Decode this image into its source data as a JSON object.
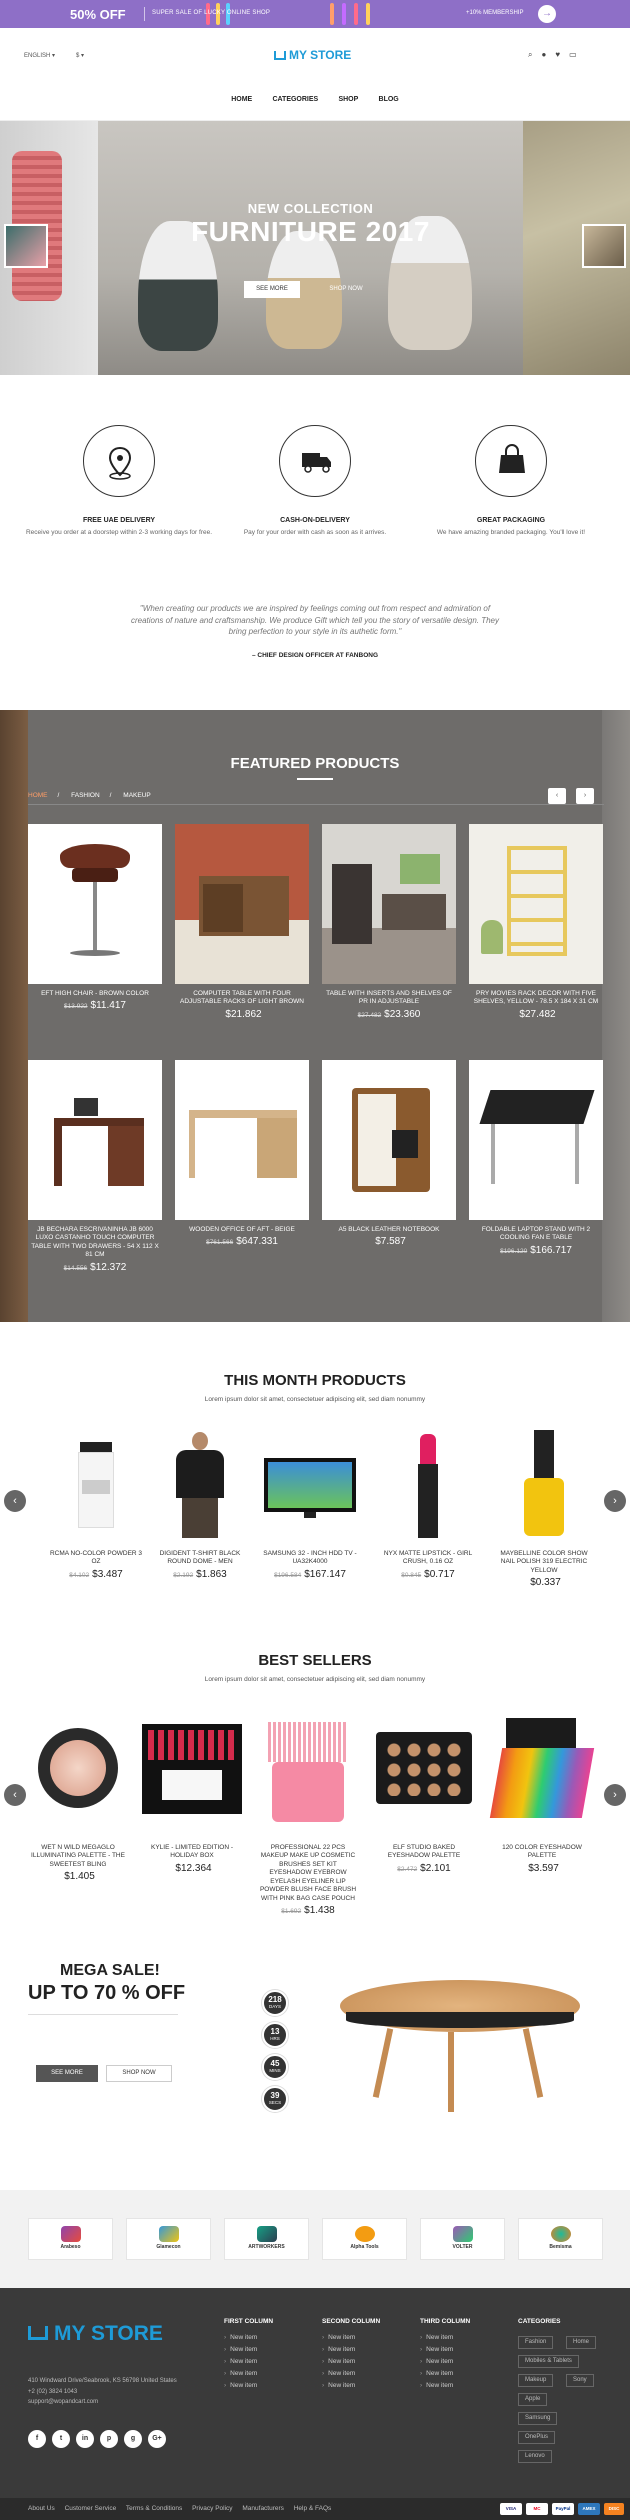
{
  "promo": {
    "percent": "50% OFF",
    "sale_text": "SUPER SALE OF LUCKY ONLINE SHOP",
    "membership": "+10% MEMBERSHIP",
    "arrow": "→"
  },
  "header": {
    "language": "ENGLISH",
    "currency": "$",
    "logo": "MY STORE",
    "icons": [
      "search-icon",
      "user-icon",
      "heart-icon",
      "cart-icon"
    ],
    "nav": [
      "HOME",
      "CATEGORIES",
      "SHOP",
      "BLOG"
    ]
  },
  "hero": {
    "kicker": "NEW COLLECTION",
    "title": "FURNITURE 2017",
    "btn_primary": "SEE MORE",
    "btn_secondary": "SHOP NOW"
  },
  "features": [
    {
      "title": "FREE UAE DELIVERY",
      "desc": "Receive you order at a doorstep within 2-3 working days for free.",
      "icon": "map-pin-icon"
    },
    {
      "title": "CASH-ON-DELIVERY",
      "desc": "Pay for your order with cash as soon as it arrives.",
      "icon": "truck-icon"
    },
    {
      "title": "GREAT PACKAGING",
      "desc": "We have amazing branded packaging. You'll love it!",
      "icon": "shopping-bag-icon"
    }
  ],
  "quote": {
    "text": "\"When creating our products we are inspired by feelings coming out from respect and admiration of creations of nature and craftsmanship. We produce Gift which tell you the story of versatile design. They bring perfection to your style in its authetic form.\"",
    "author": "– CHIEF DESIGN OFFICER AT FANBONG"
  },
  "featured": {
    "title": "FEATURED PRODUCTS",
    "tabs": [
      "HOME",
      "FASHION",
      "MAKEUP"
    ],
    "products": [
      {
        "name": "EFT HIGH CHAIR - BROWN COLOR",
        "old": "$13.922",
        "price": "$11.417"
      },
      {
        "name": "COMPUTER TABLE WITH FOUR ADJUSTABLE RACKS OF LIGHT BROWN",
        "old": "",
        "price": "$21.862"
      },
      {
        "name": "TABLE WITH INSERTS AND SHELVES OF PR IN ADJUSTABLE",
        "old": "$27.482",
        "price": "$23.360"
      },
      {
        "name": "PRY MOVIES RACK DECOR WITH FIVE SHELVES, YELLOW - 78.5 X 184 X 31 CM",
        "old": "",
        "price": "$27.482"
      },
      {
        "name": "JB BECHARA ESCRIVANINHA JB 6000 LUXO CASTANHO TOUCH COMPUTER TABLE WITH TWO DRAWERS - 54 X 112 X 81 CM",
        "old": "$14.556",
        "price": "$12.372"
      },
      {
        "name": "WOODEN OFFICE OF AFT - BEIGE",
        "old": "$761.566",
        "price": "$647.331"
      },
      {
        "name": "A5 BLACK LEATHER NOTEBOOK",
        "old": "",
        "price": "$7.587"
      },
      {
        "name": "FOLDABLE LAPTOP STAND WITH 2 COOLING FAN E TABLE",
        "old": "$196.120",
        "price": "$166.717"
      }
    ]
  },
  "month": {
    "title": "THIS MONTH PRODUCTS",
    "subtitle": "Lorem ipsum dolor sit amet, consectetuer adipiscing elit, sed diam nonummy",
    "items": [
      {
        "name": "RCMA NO-COLOR POWDER 3 OZ",
        "old": "$4.102",
        "price": "$3.487"
      },
      {
        "name": "DIGIDENT T-SHIRT BLACK ROUND DOME - MEN",
        "old": "$2.192",
        "price": "$1.863"
      },
      {
        "name": "SAMSUNG 32 - INCH HDD TV - UA32K4000",
        "old": "$196.584",
        "price": "$167.147"
      },
      {
        "name": "NYX MATTE LIPSTICK - GIRL CRUSH, 0.16 OZ",
        "old": "$0.845",
        "price": "$0.717"
      },
      {
        "name": "MAYBELLINE COLOR SHOW NAIL POLISH 319 ELECTRIC YELLOW",
        "old": "",
        "price": "$0.337"
      }
    ]
  },
  "best": {
    "title": "BEST SELLERS",
    "subtitle": "Lorem ipsum dolor sit amet, consectetuer adipiscing elit, sed diam nonummy",
    "items": [
      {
        "name": "WET N WILD MEGAGLO ILLUMINATING PALETTE - THE SWEETEST BLING",
        "old": "",
        "price": "$1.405"
      },
      {
        "name": "KYLIE - LIMITED EDITION - HOLIDAY BOX",
        "old": "",
        "price": "$12.364"
      },
      {
        "name": "PROFESSIONAL 22 PCS MAKEUP MAKE UP COSMETIC BRUSHES SET KIT EYESHADOW EYEBROW EYELASH EYELINER LIP POWDER BLUSH FACE BRUSH WITH PINK BAG CASE POUCH",
        "old": "$1.692",
        "price": "$1.438"
      },
      {
        "name": "ELF STUDIO BAKED EYESHADOW PALETTE",
        "old": "$2.472",
        "price": "$2.101"
      },
      {
        "name": "120 COLOR EYESHADOW PALETTE",
        "old": "",
        "price": "$3.597"
      }
    ]
  },
  "mega": {
    "line1": "MEGA SALE!",
    "line2": "UP TO 70 % OFF",
    "btn1": "SEE MORE",
    "btn2": "SHOP NOW",
    "countdown": [
      {
        "n": "218",
        "u": "DAYS"
      },
      {
        "n": "13",
        "u": "HRS"
      },
      {
        "n": "45",
        "u": "MINS"
      },
      {
        "n": "39",
        "u": "SECS"
      }
    ]
  },
  "brands": [
    "Arabeso",
    "Glamecon",
    "ARTWORKERS",
    "Alpha Tools",
    "VOLTER",
    "Bemisma"
  ],
  "footer": {
    "logo": "MY STORE",
    "address": [
      "410 Windward Drive/Seabrook, KS 56798 United States",
      "+2 (02) 3824 1043",
      "support@wopandcart.com"
    ],
    "social": [
      "f",
      "t",
      "in",
      "p",
      "g",
      "G+"
    ],
    "cols": [
      {
        "title": "FIRST COLUMN",
        "items": [
          "New item",
          "New item",
          "New item",
          "New item",
          "New item"
        ]
      },
      {
        "title": "SECOND COLUMN",
        "items": [
          "New item",
          "New item",
          "New item",
          "New item",
          "New item"
        ]
      },
      {
        "title": "THIRD COLUMN",
        "items": [
          "New item",
          "New item",
          "New item",
          "New item",
          "New item"
        ]
      }
    ],
    "categories_title": "CATEGORIES",
    "categories": [
      "Fashion",
      "Home",
      "Mobiles & Tablets",
      "Makeup",
      "Sony",
      "Apple",
      "Samsung",
      "OnePlus",
      "Lenovo"
    ],
    "bottom_links": [
      "About Us",
      "Customer Service",
      "Terms & Conditions",
      "Privacy Policy",
      "Manufacturers",
      "Help & FAQs"
    ],
    "payments": [
      "VISA",
      "MC",
      "PayPal",
      "AMEX",
      "DISC"
    ]
  }
}
